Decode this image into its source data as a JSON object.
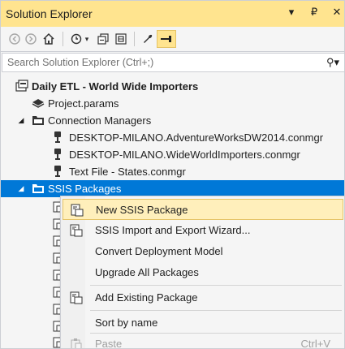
{
  "window": {
    "title": "Solution Explorer",
    "controls": {
      "dropdown": "▾",
      "pin": "₽",
      "close": "✕"
    }
  },
  "toolbar": {
    "icons": [
      "back-icon",
      "forward-icon",
      "home-icon",
      "history-icon",
      "collapse-all-icon",
      "show-all-files-icon",
      "properties-icon",
      "pin-preview-icon"
    ]
  },
  "search": {
    "placeholder": "Search Solution Explorer (Ctrl+;)"
  },
  "tree": {
    "project": "Daily ETL - World Wide Importers",
    "project_params": "Project.params",
    "connection_managers": "Connection Managers",
    "conn1": "DESKTOP-MILANO.AdventureWorksDW2014.conmgr",
    "conn2": "DESKTOP-MILANO.WideWorldImporters.conmgr",
    "conn3": "Text File - States.conmgr",
    "ssis_packages": "SSIS Packages"
  },
  "context_menu": {
    "new_package": "New SSIS Package",
    "import_export": "SSIS Import and Export Wizard...",
    "convert": "Convert Deployment Model",
    "upgrade": "Upgrade All Packages",
    "add_existing": "Add Existing Package",
    "sort": "Sort by name",
    "paste": "Paste",
    "paste_shortcut": "Ctrl+V"
  },
  "colors": {
    "title_bar": "#ffe48f",
    "selection": "#0078d7",
    "menu_highlight": "#ffefbb"
  }
}
